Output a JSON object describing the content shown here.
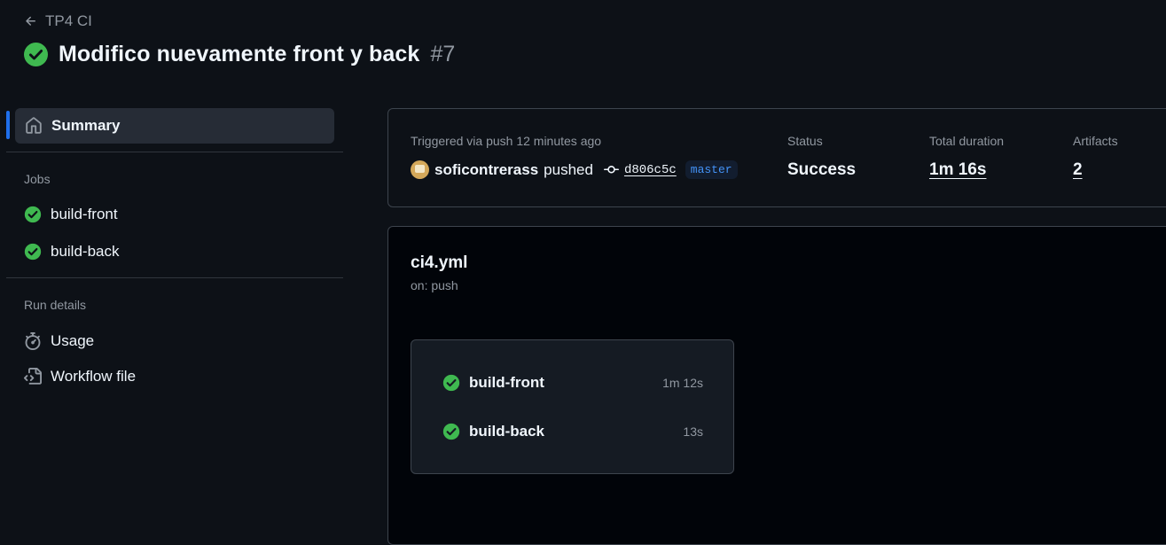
{
  "header": {
    "back_label": "TP4 CI",
    "run_title": "Modifico nuevamente front y back",
    "run_number": "#7"
  },
  "sidebar": {
    "summary_label": "Summary",
    "jobs_heading": "Jobs",
    "jobs": [
      {
        "label": "build-front"
      },
      {
        "label": "build-back"
      }
    ],
    "run_details_heading": "Run details",
    "details": [
      {
        "label": "Usage",
        "icon": "stopwatch-icon"
      },
      {
        "label": "Workflow file",
        "icon": "file-code-icon"
      }
    ]
  },
  "summary": {
    "triggered_text": "Triggered via push 12 minutes ago",
    "username": "soficontrerass",
    "action": "pushed",
    "commit_sha": "d806c5c",
    "branch": "master",
    "status_label": "Status",
    "status_value": "Success",
    "duration_label": "Total duration",
    "duration_value": "1m 16s",
    "artifacts_label": "Artifacts",
    "artifacts_value": "2"
  },
  "workflow": {
    "file_name": "ci4.yml",
    "trigger": "on: push",
    "jobs": [
      {
        "name": "build-front",
        "duration": "1m 12s",
        "status": "success"
      },
      {
        "name": "build-back",
        "duration": "13s",
        "status": "success"
      }
    ]
  },
  "colors": {
    "background": "#0d1117",
    "success": "#3fb950",
    "accent": "#1f6feb",
    "link": "#4493f8"
  }
}
